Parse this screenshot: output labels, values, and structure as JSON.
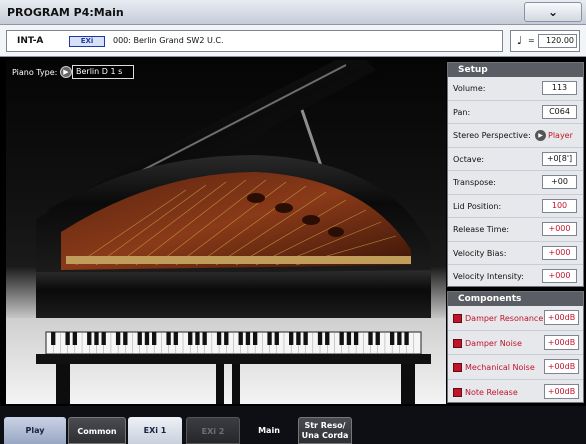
{
  "window": {
    "title": "PROGRAM P4:Main",
    "menu_icon": "chevron-down-icon",
    "menu_glyph": "⌄"
  },
  "program": {
    "bank": "INT-A",
    "type_badge": "EXi",
    "name": "000: Berlin Grand SW2 U.C.",
    "tempo_icon": "quarter-note-icon",
    "tempo_glyph": "♩",
    "tempo_eq": "=",
    "tempo": "120.00"
  },
  "piano": {
    "type_label": "Piano Type:",
    "type_value": "Berlin D 1 s"
  },
  "setup": {
    "title": "Setup",
    "rows": [
      {
        "label": "Volume:",
        "value": "113"
      },
      {
        "label": "Pan:",
        "value": "C064"
      },
      {
        "label": "Stereo Perspective:",
        "value": "Player"
      },
      {
        "label": "Octave:",
        "value": "+0[8']"
      },
      {
        "label": "Transpose:",
        "value": "+00"
      },
      {
        "label": "Lid Position:",
        "value": "100"
      },
      {
        "label": "Release Time:",
        "value": "+000"
      },
      {
        "label": "Velocity Bias:",
        "value": "+000"
      },
      {
        "label": "Velocity Intensity:",
        "value": "+000"
      }
    ]
  },
  "components": {
    "title": "Components",
    "rows": [
      {
        "label": "Damper Resonance",
        "value": "+00dB"
      },
      {
        "label": "Damper Noise",
        "value": "+00dB"
      },
      {
        "label": "Mechanical Noise",
        "value": "+00dB"
      },
      {
        "label": "Note Release",
        "value": "+00dB"
      }
    ]
  },
  "tabs": [
    {
      "label": "Play"
    },
    {
      "label": "Common"
    },
    {
      "label": "EXi 1"
    },
    {
      "label": "EXi 2"
    },
    {
      "label": "Main"
    },
    {
      "label": "Str Reso/",
      "label2": "Una Corda"
    }
  ],
  "colors": {
    "accent_red": "#c0142a",
    "panel_header": "#5a5d63",
    "tab_blue": "#9aa7c3"
  }
}
